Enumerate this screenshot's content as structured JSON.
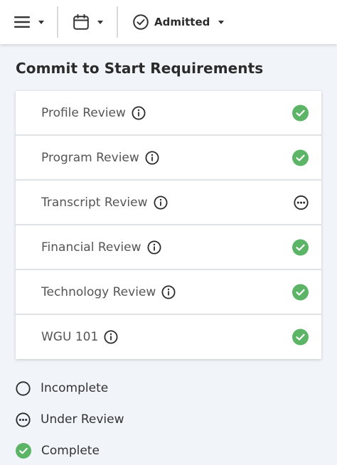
{
  "toolbar": {
    "status_label": "Admitted"
  },
  "page": {
    "heading": "Commit to Start Requirements"
  },
  "requirements": [
    {
      "label": "Profile Review",
      "state": "complete"
    },
    {
      "label": "Program Review",
      "state": "complete"
    },
    {
      "label": "Transcript Review",
      "state": "under-review"
    },
    {
      "label": "Financial Review",
      "state": "complete"
    },
    {
      "label": "Technology Review",
      "state": "complete"
    },
    {
      "label": "WGU 101",
      "state": "complete"
    }
  ],
  "legend": {
    "incomplete": "Incomplete",
    "under_review": "Under Review",
    "complete": "Complete"
  },
  "colors": {
    "complete": "#5cb567",
    "text": "#555555",
    "heading": "#2b2b2b"
  },
  "icons": {
    "menu": "hamburger-icon",
    "calendar": "calendar-icon",
    "status": "check-circle-icon",
    "info": "info-icon"
  }
}
